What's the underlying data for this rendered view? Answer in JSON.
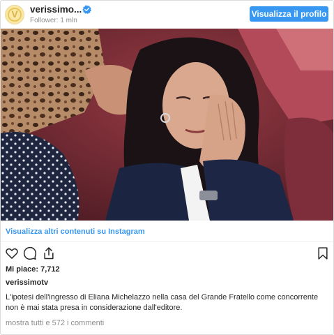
{
  "header": {
    "account_name": "verissimo...",
    "followers_text": "Follower: 1 mln",
    "view_profile_label": "Visualizza il profilo",
    "avatar_icon": "verissimo-logo-icon",
    "verified_icon": "verified-badge-icon"
  },
  "post": {
    "image_alt": "post-photo",
    "more_content_link": "Visualizza altri contenuti su Instagram",
    "likes_text": "Mi piace: 7,712",
    "owner": "verissimotv",
    "caption": "L'ipotesi dell'ingresso di Eliana Michelazzo nella casa del Grande Fratello come concorrente non è mai stata presa in considerazione dall'editore.",
    "comments_text": "mostra tutti e 572 i commenti"
  },
  "actions": {
    "like_icon": "heart-icon",
    "comment_icon": "comment-icon",
    "share_icon": "share-icon",
    "save_icon": "bookmark-icon"
  },
  "colors": {
    "accent": "#3897f0",
    "muted": "#8e8e8e",
    "text": "#262626"
  }
}
